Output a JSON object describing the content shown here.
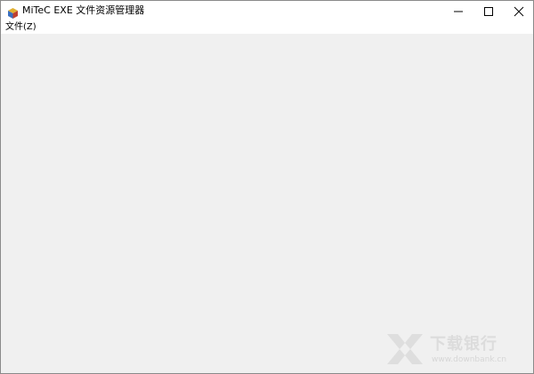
{
  "window": {
    "title": "MiTeC EXE 文件资源管理器",
    "controls": {
      "minimize": "minimize-icon",
      "maximize": "maximize-icon",
      "close": "close-icon"
    }
  },
  "menubar": {
    "items": [
      {
        "label": "文件(Z)"
      }
    ]
  },
  "watermark": {
    "name": "下载银行",
    "url": "www.downbank.cn"
  },
  "colors": {
    "client_background": "#f0f0f0",
    "titlebar_background": "#ffffff",
    "watermark": "#dcdcdc"
  }
}
